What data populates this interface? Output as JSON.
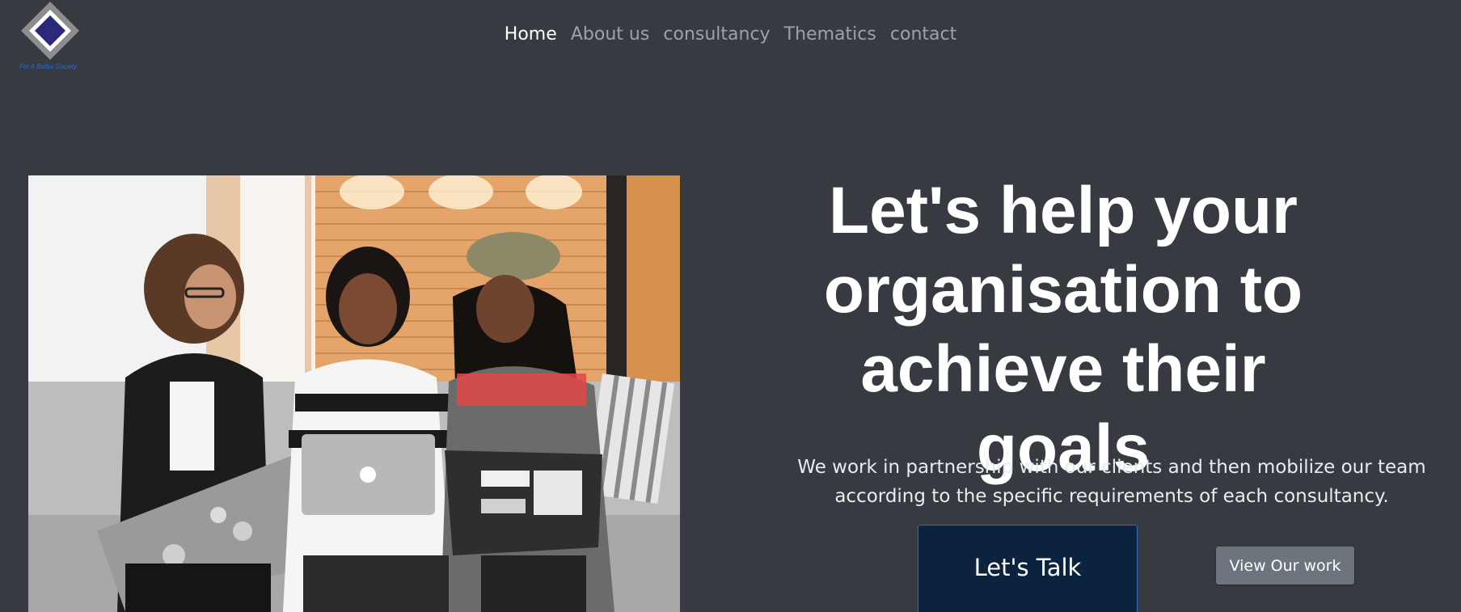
{
  "brand": {
    "tagline": "For A Better Society"
  },
  "nav": {
    "items": [
      {
        "label": "Home",
        "active": true
      },
      {
        "label": "About us",
        "active": false
      },
      {
        "label": "consultancy",
        "active": false
      },
      {
        "label": "Thematics",
        "active": false
      },
      {
        "label": "contact",
        "active": false
      }
    ]
  },
  "hero": {
    "title": "Let's help your organisation to achieve their goals",
    "text": "We work in partnership with our clients and then mobilize our team according to the specific requirements of each consultancy.",
    "primary_button": "Let's Talk",
    "secondary_button": "View Our work",
    "image_alt": "Three women working on laptops on a sofa"
  },
  "colors": {
    "background": "#373a41",
    "nav_active": "#ffffff",
    "nav_inactive": "#9da2a8",
    "primary_button": "#0c2340",
    "secondary_button": "#6c757d",
    "logo_inner": "#2b2a7a"
  }
}
